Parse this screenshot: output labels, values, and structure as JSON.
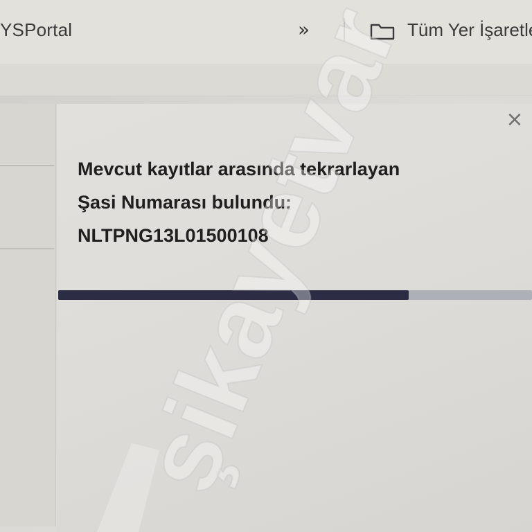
{
  "bookmarks_bar": {
    "left_bookmark": "YSPortal",
    "overflow_chevron": "»",
    "all_bookmarks_label": "Tüm Yer İşaretle"
  },
  "dialog": {
    "close_glyph": "×",
    "message_lines": [
      "Mevcut kayıtlar arasında tekrarlayan",
      "Şasi Numarası bulundu:",
      "NLTPNG13L01500108"
    ],
    "progress_percent": 74
  },
  "icons": {
    "folder": "folder-icon",
    "close": "close-icon",
    "chevron": "double-chevron-right-icon"
  },
  "colors": {
    "progress_fill": "#2c2d45",
    "progress_track": "#aeb0b8",
    "text": "#1f1f1f"
  },
  "watermark": {
    "text": "şikayetvar"
  }
}
